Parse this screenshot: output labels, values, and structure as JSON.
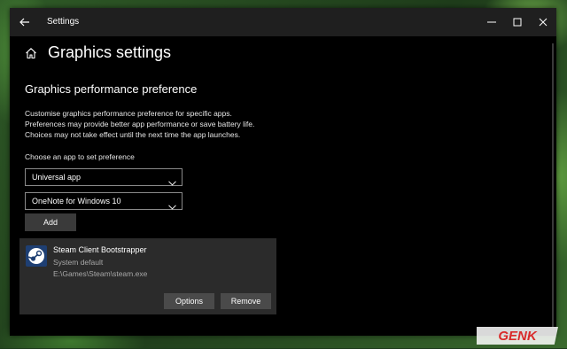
{
  "window": {
    "title": "Settings"
  },
  "page": {
    "title": "Graphics settings"
  },
  "section": {
    "title": "Graphics performance preference",
    "description": [
      "Customise graphics performance preference for specific apps.",
      "Preferences may provide better app performance or save battery life.",
      "Choices may not take effect until the next time the app launches."
    ],
    "choose_label": "Choose an app to set preference"
  },
  "app_type_dropdown": {
    "value": "Universal app"
  },
  "app_dropdown": {
    "value": "OneNote for Windows 10"
  },
  "add_button": {
    "label": "Add"
  },
  "app_card": {
    "name": "Steam Client Bootstrapper",
    "preference": "System default",
    "path": "E:\\Games\\Steam\\steam.exe",
    "options_label": "Options",
    "remove_label": "Remove"
  },
  "watermark": {
    "text": "GENK",
    "color": "#d92a2a"
  },
  "colors": {
    "window_bg": "#000000",
    "titlebar_bg": "#1f1f1f",
    "card_bg": "#2b2b2b",
    "button_bg": "#3a3a3a"
  }
}
